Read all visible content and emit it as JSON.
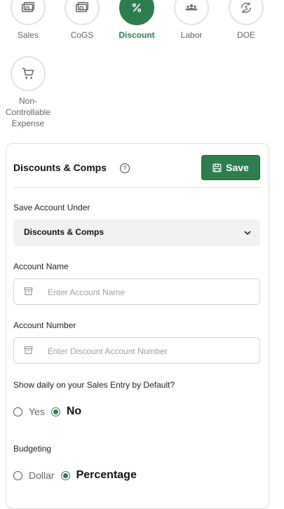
{
  "categories": [
    {
      "label": "Sales",
      "icon": "cash-icon",
      "active": false
    },
    {
      "label": "CoGS",
      "icon": "cash-icon",
      "active": false
    },
    {
      "label": "Discount",
      "icon": "percent-icon",
      "active": true
    },
    {
      "label": "Labor",
      "icon": "people-icon",
      "active": false
    },
    {
      "label": "DOE",
      "icon": "dollar-cycle-icon",
      "active": false
    },
    {
      "label": "Non-\nControllable\nExpense",
      "icon": "cart-icon",
      "active": false
    }
  ],
  "panel": {
    "title": "Discounts & Comps",
    "save_label": "Save"
  },
  "save_account_under": {
    "label": "Save Account Under",
    "value": "Discounts & Comps"
  },
  "account_name": {
    "label": "Account Name",
    "placeholder": "Enter Account Name"
  },
  "account_number": {
    "label": "Account Number",
    "placeholder": "Enter Discount Account Number"
  },
  "show_daily": {
    "label": "Show daily on your Sales Entry by Default?",
    "options": [
      "Yes",
      "No"
    ],
    "selected": "No"
  },
  "budgeting": {
    "label": "Budgeting",
    "options": [
      "Dollar",
      "Percentage"
    ],
    "selected": "Percentage"
  },
  "colors": {
    "accent": "#2e7d4f",
    "border": "#dcdcdc",
    "select_bg": "#f1f1f1"
  }
}
